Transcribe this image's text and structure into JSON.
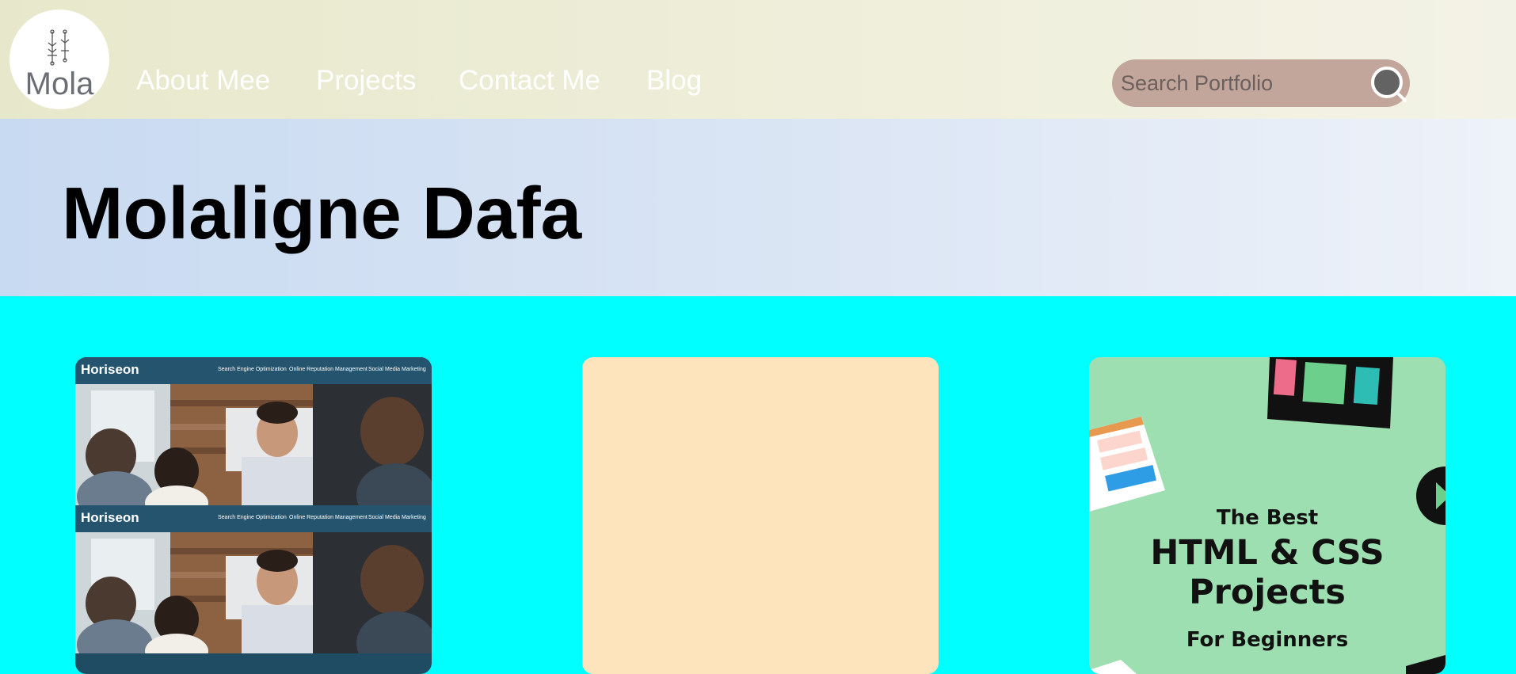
{
  "header": {
    "logo_text": "Mola",
    "nav": [
      {
        "label": "About Mee"
      },
      {
        "label": "Projects"
      },
      {
        "label": "Contact Me"
      },
      {
        "label": "Blog"
      }
    ],
    "search": {
      "placeholder": "Search Portfolio"
    }
  },
  "hero": {
    "title": "Molaligne Dafa"
  },
  "projects": [
    {
      "preview": {
        "brand": "Horiseon",
        "nav": [
          "Search Engine Optimization",
          "Online Reputation Management",
          "Social Media Marketing"
        ]
      }
    },
    {},
    {
      "preview": {
        "line1": "The Best",
        "line2": "HTML & CSS",
        "line3": "Projects",
        "line4": "For Beginners"
      }
    }
  ],
  "colors": {
    "header_bg": "#e7e8cb",
    "hero_bg": "#c8daf1",
    "main_bg": "#00ffff",
    "search_bg": "#c2a69b",
    "card_peach": "#fde4bd",
    "card_green": "#9ddfb1"
  },
  "icons": {
    "logo": "circuit-icon",
    "search": "search-icon"
  }
}
